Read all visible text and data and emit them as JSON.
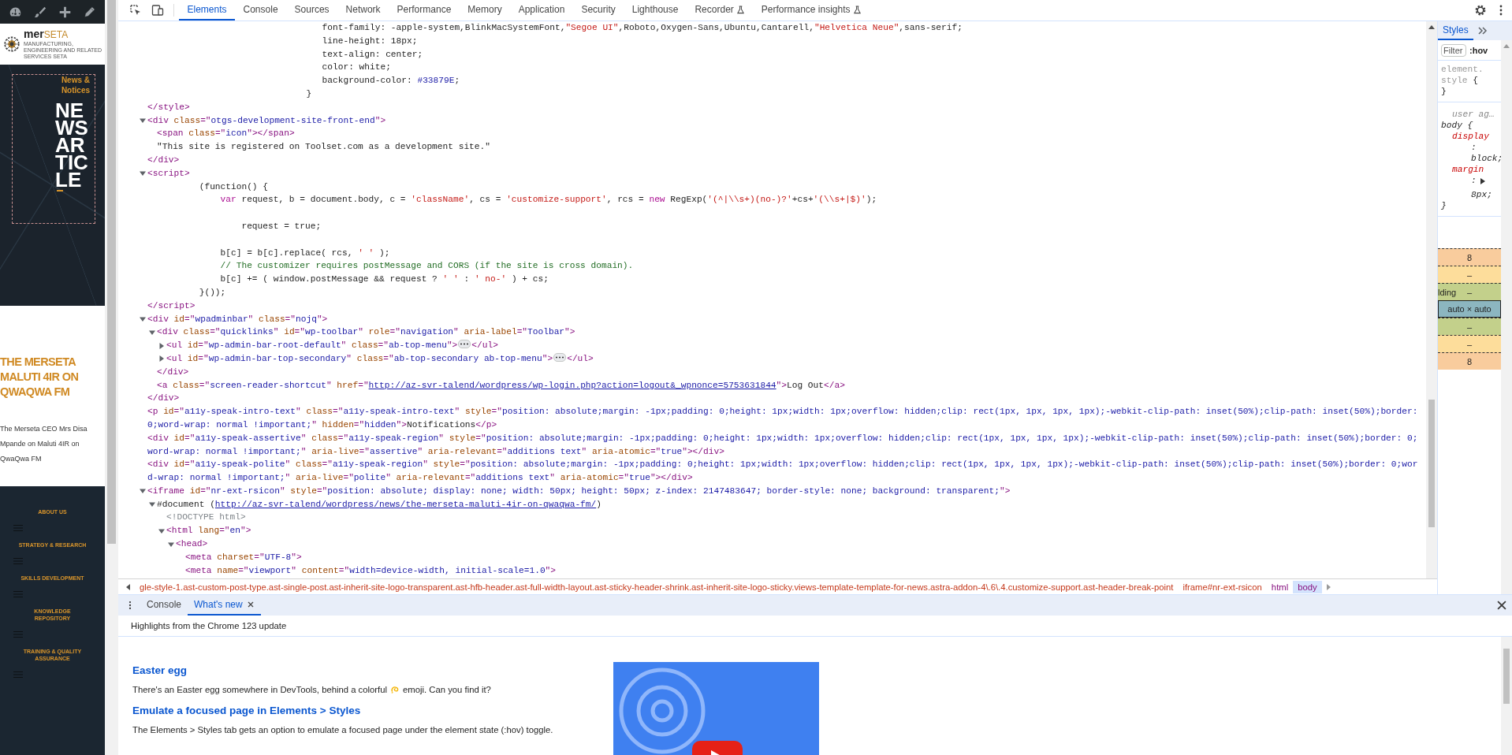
{
  "page_preview": {
    "logo": {
      "name": "mer",
      "name_accent": "SETA",
      "tagline": "MANUFACTURING, ENGINEERING AND RELATED SERVICES SETA"
    },
    "hero": {
      "kicker": "News & Notices",
      "title": "NEWS ARTICLE"
    },
    "post": {
      "title": "THE MERSETA MALUTI 4IR ON QWAQWA FM",
      "excerpt": "The Merseta CEO Mrs Disa Mpande on Maluti 4IR on QwaQwa FM"
    },
    "footer_menu": [
      {
        "label": "ABOUT US"
      },
      {
        "label": "STRATEGY & RESEARCH"
      },
      {
        "label": "SKILLS DEVELOPMENT"
      },
      {
        "label": "KNOWLEDGE REPOSITORY"
      },
      {
        "label": "TRAINING & QUALITY ASSURANCE"
      }
    ]
  },
  "devtools": {
    "tabs": [
      {
        "label": "Elements",
        "selected": true,
        "experimental": false
      },
      {
        "label": "Console",
        "selected": false,
        "experimental": false
      },
      {
        "label": "Sources",
        "selected": false,
        "experimental": false
      },
      {
        "label": "Network",
        "selected": false,
        "experimental": false
      },
      {
        "label": "Performance",
        "selected": false,
        "experimental": false
      },
      {
        "label": "Memory",
        "selected": false,
        "experimental": false
      },
      {
        "label": "Application",
        "selected": false,
        "experimental": false
      },
      {
        "label": "Security",
        "selected": false,
        "experimental": false
      },
      {
        "label": "Lighthouse",
        "selected": false,
        "experimental": false
      },
      {
        "label": "Recorder",
        "selected": false,
        "experimental": true
      },
      {
        "label": "Performance insights",
        "selected": false,
        "experimental": true
      }
    ],
    "tree": [
      {
        "line": [
          {
            "kind": "text",
            "text": "                                 font-family: -apple-system,BlinkMacSystemFont,"
          },
          {
            "kind": "str",
            "text": "\"Segoe UI\""
          },
          {
            "kind": "text",
            "text": ",Roboto,Oxygen-Sans,Ubuntu,Cantarell,"
          },
          {
            "kind": "str",
            "text": "\"Helvetica Neue\""
          },
          {
            "kind": "text",
            "text": ",sans-serif;\n                                 line-height: 18px;\n                                 text-align: center;\n                                 color: white;\n                                 background-color: "
          },
          {
            "kind": "num",
            "text": "#33879E"
          },
          {
            "kind": "text",
            "text": ";\n                              }"
          }
        ]
      },
      {
        "line": [
          {
            "kind": "tag",
            "text": "</style>"
          }
        ]
      },
      {
        "expanded": true,
        "line": [
          {
            "kind": "tag",
            "text": "<div"
          },
          {
            "kind": "attr",
            "text": " class"
          },
          {
            "kind": "tag",
            "text": "=\""
          },
          {
            "kind": "val",
            "text": "otgs-development-site-front-end"
          },
          {
            "kind": "tag",
            "text": "\">"
          }
        ],
        "children": [
          {
            "line": [
              {
                "kind": "tag",
                "text": "<span"
              },
              {
                "kind": "attr",
                "text": " class"
              },
              {
                "kind": "tag",
                "text": "=\""
              },
              {
                "kind": "val",
                "text": "icon"
              },
              {
                "kind": "tag",
                "text": "\"></span>"
              }
            ]
          },
          {
            "line": [
              {
                "kind": "text",
                "text": "\"This site is registered on Toolset.com as a development site.\""
              }
            ]
          }
        ],
        "close": [
          {
            "kind": "tag",
            "text": "</div>"
          }
        ]
      },
      {
        "expanded": true,
        "line": [
          {
            "kind": "tag",
            "text": "<script>"
          }
        ],
        "children": [
          {
            "line": [
              {
                "kind": "text",
                "text": "        (function() {\n            "
              },
              {
                "kind": "kw",
                "text": "var"
              },
              {
                "kind": "text",
                "text": " request, b = document.body, c = "
              },
              {
                "kind": "str",
                "text": "'className'"
              },
              {
                "kind": "text",
                "text": ", cs = "
              },
              {
                "kind": "str",
                "text": "'customize-support'"
              },
              {
                "kind": "text",
                "text": ", rcs = "
              },
              {
                "kind": "kw",
                "text": "new"
              },
              {
                "kind": "text",
                "text": " RegExp("
              },
              {
                "kind": "str",
                "text": "'(^|\\\\s+)(no-)?'"
              },
              {
                "kind": "text",
                "text": "+cs+"
              },
              {
                "kind": "str",
                "text": "'(\\\\s+|$)'"
              },
              {
                "kind": "text",
                "text": ");\n\n                request = true;\n\n            b[c] = b[c].replace( rcs, "
              },
              {
                "kind": "str",
                "text": "' '"
              },
              {
                "kind": "text",
                "text": " );\n            "
              },
              {
                "kind": "com",
                "text": "// The customizer requires postMessage and CORS (if the site is cross domain)."
              },
              {
                "kind": "text",
                "text": "\n            b[c] += ( window.postMessage && request ? "
              },
              {
                "kind": "str",
                "text": "' '"
              },
              {
                "kind": "text",
                "text": " : "
              },
              {
                "kind": "str",
                "text": "' no-'"
              },
              {
                "kind": "text",
                "text": " ) + cs;\n        }());"
              }
            ]
          }
        ],
        "close": [
          {
            "kind": "tag",
            "text": "</script>"
          }
        ]
      },
      {
        "expanded": true,
        "line": [
          {
            "kind": "tag",
            "text": "<div"
          },
          {
            "kind": "attr",
            "text": " id"
          },
          {
            "kind": "tag",
            "text": "=\""
          },
          {
            "kind": "val",
            "text": "wpadminbar"
          },
          {
            "kind": "tag",
            "text": "\""
          },
          {
            "kind": "attr",
            "text": " class"
          },
          {
            "kind": "tag",
            "text": "=\""
          },
          {
            "kind": "val",
            "text": "nojq"
          },
          {
            "kind": "tag",
            "text": "\">"
          }
        ],
        "children": [
          {
            "expanded": true,
            "line": [
              {
                "kind": "tag",
                "text": "<div"
              },
              {
                "kind": "attr",
                "text": " class"
              },
              {
                "kind": "tag",
                "text": "=\""
              },
              {
                "kind": "val",
                "text": "quicklinks"
              },
              {
                "kind": "tag",
                "text": "\""
              },
              {
                "kind": "attr",
                "text": " id"
              },
              {
                "kind": "tag",
                "text": "=\""
              },
              {
                "kind": "val",
                "text": "wp-toolbar"
              },
              {
                "kind": "tag",
                "text": "\""
              },
              {
                "kind": "attr",
                "text": " role"
              },
              {
                "kind": "tag",
                "text": "=\""
              },
              {
                "kind": "val",
                "text": "navigation"
              },
              {
                "kind": "tag",
                "text": "\""
              },
              {
                "kind": "attr",
                "text": " aria-label"
              },
              {
                "kind": "tag",
                "text": "=\""
              },
              {
                "kind": "val",
                "text": "Toolbar"
              },
              {
                "kind": "tag",
                "text": "\">"
              }
            ],
            "children": [
              {
                "expanded": false,
                "line": [
                  {
                    "kind": "tag",
                    "text": "<ul"
                  },
                  {
                    "kind": "attr",
                    "text": " id"
                  },
                  {
                    "kind": "tag",
                    "text": "=\""
                  },
                  {
                    "kind": "val",
                    "text": "wp-admin-bar-root-default"
                  },
                  {
                    "kind": "tag",
                    "text": "\""
                  },
                  {
                    "kind": "attr",
                    "text": " class"
                  },
                  {
                    "kind": "tag",
                    "text": "=\""
                  },
                  {
                    "kind": "val",
                    "text": "ab-top-menu"
                  },
                  {
                    "kind": "tag",
                    "text": "\">"
                  },
                  {
                    "kind": "dots"
                  },
                  {
                    "kind": "tag",
                    "text": "</ul>"
                  }
                ]
              },
              {
                "expanded": false,
                "line": [
                  {
                    "kind": "tag",
                    "text": "<ul"
                  },
                  {
                    "kind": "attr",
                    "text": " id"
                  },
                  {
                    "kind": "tag",
                    "text": "=\""
                  },
                  {
                    "kind": "val",
                    "text": "wp-admin-bar-top-secondary"
                  },
                  {
                    "kind": "tag",
                    "text": "\""
                  },
                  {
                    "kind": "attr",
                    "text": " class"
                  },
                  {
                    "kind": "tag",
                    "text": "=\""
                  },
                  {
                    "kind": "val",
                    "text": "ab-top-secondary ab-top-menu"
                  },
                  {
                    "kind": "tag",
                    "text": "\">"
                  },
                  {
                    "kind": "dots"
                  },
                  {
                    "kind": "tag",
                    "text": "</ul>"
                  }
                ]
              }
            ],
            "close": [
              {
                "kind": "tag",
                "text": "</div>"
              }
            ]
          },
          {
            "line": [
              {
                "kind": "tag",
                "text": "<a"
              },
              {
                "kind": "attr",
                "text": " class"
              },
              {
                "kind": "tag",
                "text": "=\""
              },
              {
                "kind": "val",
                "text": "screen-reader-shortcut"
              },
              {
                "kind": "tag",
                "text": "\""
              },
              {
                "kind": "attr",
                "text": " href"
              },
              {
                "kind": "tag",
                "text": "=\""
              },
              {
                "kind": "link",
                "text": "http://az-svr-talend/wordpress/wp-login.php?action=logout&_wpnonce=5753631844"
              },
              {
                "kind": "tag",
                "text": "\">"
              },
              {
                "kind": "text",
                "text": "Log Out"
              },
              {
                "kind": "tag",
                "text": "</a>"
              }
            ]
          }
        ],
        "close": [
          {
            "kind": "tag",
            "text": "</div>"
          }
        ]
      },
      {
        "line": [
          {
            "kind": "tag",
            "text": "<p"
          },
          {
            "kind": "attr",
            "text": " id"
          },
          {
            "kind": "tag",
            "text": "=\""
          },
          {
            "kind": "val",
            "text": "a11y-speak-intro-text"
          },
          {
            "kind": "tag",
            "text": "\""
          },
          {
            "kind": "attr",
            "text": " class"
          },
          {
            "kind": "tag",
            "text": "=\""
          },
          {
            "kind": "val",
            "text": "a11y-speak-intro-text"
          },
          {
            "kind": "tag",
            "text": "\""
          },
          {
            "kind": "attr",
            "text": " style"
          },
          {
            "kind": "tag",
            "text": "=\""
          },
          {
            "kind": "val",
            "text": "position: absolute;margin: -1px;padding: 0;height: 1px;width: 1px;overflow: hidden;clip: rect(1px, 1px, 1px, 1px);-webkit-clip-path: inset(50%);clip-path: inset(50%);border: 0;word-wrap: normal !important;"
          },
          {
            "kind": "tag",
            "text": "\""
          },
          {
            "kind": "attr",
            "text": " hidden"
          },
          {
            "kind": "tag",
            "text": "=\""
          },
          {
            "kind": "val",
            "text": "hidden"
          },
          {
            "kind": "tag",
            "text": "\">"
          },
          {
            "kind": "text",
            "text": "Notifications"
          },
          {
            "kind": "tag",
            "text": "</p>"
          }
        ]
      },
      {
        "line": [
          {
            "kind": "tag",
            "text": "<div"
          },
          {
            "kind": "attr",
            "text": " id"
          },
          {
            "kind": "tag",
            "text": "=\""
          },
          {
            "kind": "val",
            "text": "a11y-speak-assertive"
          },
          {
            "kind": "tag",
            "text": "\""
          },
          {
            "kind": "attr",
            "text": " class"
          },
          {
            "kind": "tag",
            "text": "=\""
          },
          {
            "kind": "val",
            "text": "a11y-speak-region"
          },
          {
            "kind": "tag",
            "text": "\""
          },
          {
            "kind": "attr",
            "text": " style"
          },
          {
            "kind": "tag",
            "text": "=\""
          },
          {
            "kind": "val",
            "text": "position: absolute;margin: -1px;padding: 0;height: 1px;width: 1px;overflow: hidden;clip: rect(1px, 1px, 1px, 1px);-webkit-clip-path: inset(50%);clip-path: inset(50%);border: 0;word-wrap: normal !important;"
          },
          {
            "kind": "tag",
            "text": "\""
          },
          {
            "kind": "attr",
            "text": " aria-live"
          },
          {
            "kind": "tag",
            "text": "=\""
          },
          {
            "kind": "val",
            "text": "assertive"
          },
          {
            "kind": "tag",
            "text": "\""
          },
          {
            "kind": "attr",
            "text": " aria-relevant"
          },
          {
            "kind": "tag",
            "text": "=\""
          },
          {
            "kind": "val",
            "text": "additions text"
          },
          {
            "kind": "tag",
            "text": "\""
          },
          {
            "kind": "attr",
            "text": " aria-atomic"
          },
          {
            "kind": "tag",
            "text": "=\""
          },
          {
            "kind": "val",
            "text": "true"
          },
          {
            "kind": "tag",
            "text": "\"></div>"
          }
        ]
      },
      {
        "line": [
          {
            "kind": "tag",
            "text": "<div"
          },
          {
            "kind": "attr",
            "text": " id"
          },
          {
            "kind": "tag",
            "text": "=\""
          },
          {
            "kind": "val",
            "text": "a11y-speak-polite"
          },
          {
            "kind": "tag",
            "text": "\""
          },
          {
            "kind": "attr",
            "text": " class"
          },
          {
            "kind": "tag",
            "text": "=\""
          },
          {
            "kind": "val",
            "text": "a11y-speak-region"
          },
          {
            "kind": "tag",
            "text": "\""
          },
          {
            "kind": "attr",
            "text": " style"
          },
          {
            "kind": "tag",
            "text": "=\""
          },
          {
            "kind": "val",
            "text": "position: absolute;margin: -1px;padding: 0;height: 1px;width: 1px;overflow: hidden;clip: rect(1px, 1px, 1px, 1px);-webkit-clip-path: inset(50%);clip-path: inset(50%);border: 0;word-wrap: normal !important;"
          },
          {
            "kind": "tag",
            "text": "\""
          },
          {
            "kind": "attr",
            "text": " aria-live"
          },
          {
            "kind": "tag",
            "text": "=\""
          },
          {
            "kind": "val",
            "text": "polite"
          },
          {
            "kind": "tag",
            "text": "\""
          },
          {
            "kind": "attr",
            "text": " aria-relevant"
          },
          {
            "kind": "tag",
            "text": "=\""
          },
          {
            "kind": "val",
            "text": "additions text"
          },
          {
            "kind": "tag",
            "text": "\""
          },
          {
            "kind": "attr",
            "text": " aria-atomic"
          },
          {
            "kind": "tag",
            "text": "=\""
          },
          {
            "kind": "val",
            "text": "true"
          },
          {
            "kind": "tag",
            "text": "\"></div>"
          }
        ]
      },
      {
        "expanded": true,
        "line": [
          {
            "kind": "tag",
            "text": "<iframe"
          },
          {
            "kind": "attr",
            "text": " id"
          },
          {
            "kind": "tag",
            "text": "=\""
          },
          {
            "kind": "val",
            "text": "nr-ext-rsicon"
          },
          {
            "kind": "tag",
            "text": "\""
          },
          {
            "kind": "attr",
            "text": " style"
          },
          {
            "kind": "tag",
            "text": "=\""
          },
          {
            "kind": "val",
            "text": "position: absolute; display: none; width: 50px; height: 50px; z-index: 2147483647; border-style: none; background: transparent;"
          },
          {
            "kind": "tag",
            "text": "\">"
          }
        ],
        "children": [
          {
            "expanded": true,
            "line": [
              {
                "kind": "text",
                "text": "#document ("
              },
              {
                "kind": "link",
                "text": "http://az-svr-talend/wordpress/news/the-merseta-maluti-4ir-on-qwaqwa-fm/"
              },
              {
                "kind": "text",
                "text": ")"
              }
            ],
            "children": [
              {
                "line": [
                  {
                    "kind": "doc",
                    "text": "<!DOCTYPE html>"
                  }
                ]
              },
              {
                "expanded": true,
                "line": [
                  {
                    "kind": "tag",
                    "text": "<html"
                  },
                  {
                    "kind": "attr",
                    "text": " lang"
                  },
                  {
                    "kind": "tag",
                    "text": "=\""
                  },
                  {
                    "kind": "val",
                    "text": "en"
                  },
                  {
                    "kind": "tag",
                    "text": "\">"
                  }
                ],
                "children": [
                  {
                    "expanded": true,
                    "line": [
                      {
                        "kind": "tag",
                        "text": "<head>"
                      }
                    ],
                    "children": [
                      {
                        "line": [
                          {
                            "kind": "tag",
                            "text": "<meta"
                          },
                          {
                            "kind": "attr",
                            "text": " charset"
                          },
                          {
                            "kind": "tag",
                            "text": "=\""
                          },
                          {
                            "kind": "val",
                            "text": "UTF-8"
                          },
                          {
                            "kind": "tag",
                            "text": "\">"
                          }
                        ]
                      },
                      {
                        "line": [
                          {
                            "kind": "tag",
                            "text": "<meta"
                          },
                          {
                            "kind": "attr",
                            "text": " name"
                          },
                          {
                            "kind": "tag",
                            "text": "=\""
                          },
                          {
                            "kind": "val",
                            "text": "viewport"
                          },
                          {
                            "kind": "tag",
                            "text": "\""
                          },
                          {
                            "kind": "attr",
                            "text": " content"
                          },
                          {
                            "kind": "tag",
                            "text": "=\""
                          },
                          {
                            "kind": "val",
                            "text": "width=device-width, initial-scale=1.0"
                          },
                          {
                            "kind": "tag",
                            "text": "\">"
                          }
                        ]
                      }
                    ]
                  }
                ]
              }
            ]
          }
        ]
      }
    ],
    "breadcrumbs": [
      {
        "label": "gle-style-1.ast-custom-post-type.ast-single-post.ast-inherit-site-logo-transparent.ast-hfb-header.ast-full-width-layout.ast-sticky-header-shrink.ast-inherit-site-logo-sticky.views-template-template-for-news.astra-addon-4\\.6\\.4.customize-support.ast-header-break-point",
        "kind": "selector",
        "selected": false
      },
      {
        "label": "iframe#nr-ext-rsicon",
        "kind": "selector",
        "selected": false
      },
      {
        "label": "html",
        "kind": "tag",
        "selected": false
      },
      {
        "label": "body",
        "kind": "tag",
        "selected": true
      }
    ],
    "styles": {
      "tabs": [
        {
          "label": "Styles",
          "selected": true
        }
      ],
      "filter": {
        "placeholder": "Filter"
      },
      "hov": ":hov",
      "rules": [
        {
          "kind": "inline",
          "selector": "element.style",
          "open": "{",
          "close": "}"
        },
        {
          "kind": "user-agent",
          "origin": "user ag…",
          "selector": "body",
          "open": "{",
          "declarations": [
            {
              "name": "display",
              "colon": ":",
              "value": "block;",
              "expandable": false
            },
            {
              "name": "margin",
              "colon": ":",
              "value": "8px;",
              "expandable": true
            }
          ],
          "close": "}"
        }
      ],
      "box_model": [
        {
          "kind": "margin",
          "value": "8"
        },
        {
          "kind": "border",
          "value": "–"
        },
        {
          "kind": "padding",
          "label": "lding",
          "value": "–"
        },
        {
          "kind": "content",
          "value": "auto × auto"
        },
        {
          "kind": "padding",
          "value": "–"
        },
        {
          "kind": "border",
          "value": "–"
        },
        {
          "kind": "margin",
          "value": "8"
        }
      ]
    },
    "drawer": {
      "tabs": [
        {
          "label": "Console",
          "selected": false,
          "closable": false
        },
        {
          "label": "What's new",
          "selected": true,
          "closable": true
        }
      ],
      "header": "Highlights from the Chrome 123 update",
      "articles": [
        {
          "heading": "Easter egg",
          "body": [
            "There's an Easter egg somewhere in DevTools, behind a colorful",
            "emoji. Can you find it?"
          ]
        },
        {
          "heading": "Emulate a focused page in Elements > Styles",
          "body": [
            "The Elements > Styles tab gets an option to emulate a focused page under the element state (:hov) toggle."
          ]
        }
      ]
    }
  }
}
